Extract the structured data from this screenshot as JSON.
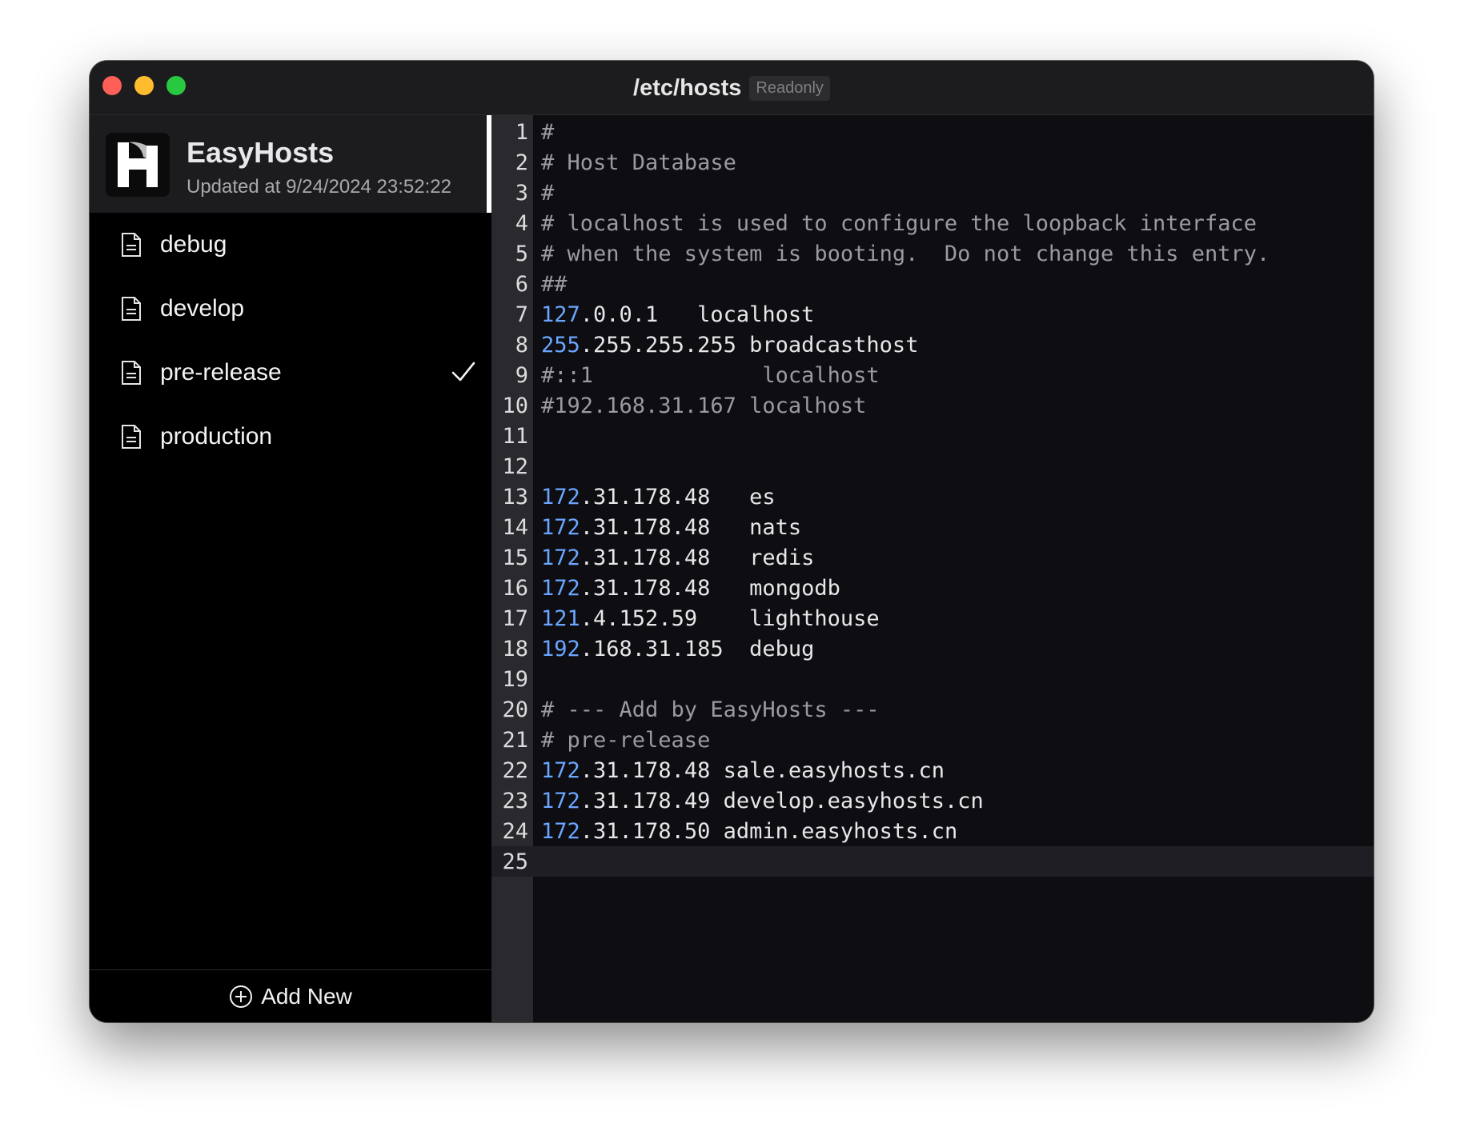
{
  "window": {
    "title": "/etc/hosts",
    "badge": "Readonly"
  },
  "app": {
    "name": "EasyHosts",
    "updated": "Updated at 9/24/2024 23:52:22",
    "logo_icon": "easyhosts-h-logo"
  },
  "profiles": [
    {
      "label": "debug",
      "checked": false
    },
    {
      "label": "develop",
      "checked": false
    },
    {
      "label": "pre-release",
      "checked": true
    },
    {
      "label": "production",
      "checked": false
    }
  ],
  "footer": {
    "add_label": "Add New",
    "add_icon": "plus-circle-icon"
  },
  "colors": {
    "comment": "#9a9aa0",
    "ip_octet": "#6aa6ff",
    "text": "#e7e7ea",
    "close": "#fe5f57",
    "minimize": "#febc2e",
    "maximize": "#28c840"
  },
  "editor": {
    "active_line": 25,
    "lines": [
      {
        "n": "1",
        "type": "comment",
        "text": "#"
      },
      {
        "n": "2",
        "type": "comment",
        "text": "# Host Database"
      },
      {
        "n": "3",
        "type": "comment",
        "text": "#"
      },
      {
        "n": "4",
        "type": "comment",
        "text": "# localhost is used to configure the loopback interface"
      },
      {
        "n": "5",
        "type": "comment",
        "text": "# when the system is booting.  Do not change this entry."
      },
      {
        "n": "6",
        "type": "comment",
        "text": "##"
      },
      {
        "n": "7",
        "type": "entry",
        "ip_head": "127",
        "ip_tail": ".0.0.1",
        "gap": "   ",
        "host": "localhost"
      },
      {
        "n": "8",
        "type": "entry",
        "ip_head": "255",
        "ip_tail": ".255.255.255",
        "gap": " ",
        "host": "broadcasthost"
      },
      {
        "n": "9",
        "type": "comment",
        "text": "#::1             localhost"
      },
      {
        "n": "10",
        "type": "comment",
        "text": "#192.168.31.167 localhost"
      },
      {
        "n": "11",
        "type": "empty",
        "text": ""
      },
      {
        "n": "12",
        "type": "empty",
        "text": ""
      },
      {
        "n": "13",
        "type": "entry",
        "ip_head": "172",
        "ip_tail": ".31.178.48",
        "gap": "   ",
        "host": "es"
      },
      {
        "n": "14",
        "type": "entry",
        "ip_head": "172",
        "ip_tail": ".31.178.48",
        "gap": "   ",
        "host": "nats"
      },
      {
        "n": "15",
        "type": "entry",
        "ip_head": "172",
        "ip_tail": ".31.178.48",
        "gap": "   ",
        "host": "redis"
      },
      {
        "n": "16",
        "type": "entry",
        "ip_head": "172",
        "ip_tail": ".31.178.48",
        "gap": "   ",
        "host": "mongodb"
      },
      {
        "n": "17",
        "type": "entry",
        "ip_head": "121",
        "ip_tail": ".4.152.59",
        "gap": "    ",
        "host": "lighthouse"
      },
      {
        "n": "18",
        "type": "entry",
        "ip_head": "192",
        "ip_tail": ".168.31.185",
        "gap": "  ",
        "host": "debug"
      },
      {
        "n": "19",
        "type": "empty",
        "text": ""
      },
      {
        "n": "20",
        "type": "comment",
        "text": "# --- Add by EasyHosts ---"
      },
      {
        "n": "21",
        "type": "comment",
        "text": "# pre-release"
      },
      {
        "n": "22",
        "type": "entry",
        "ip_head": "172",
        "ip_tail": ".31.178.48",
        "gap": " ",
        "host": "sale.easyhosts.cn"
      },
      {
        "n": "23",
        "type": "entry",
        "ip_head": "172",
        "ip_tail": ".31.178.49",
        "gap": " ",
        "host": "develop.easyhosts.cn"
      },
      {
        "n": "24",
        "type": "entry",
        "ip_head": "172",
        "ip_tail": ".31.178.50",
        "gap": " ",
        "host": "admin.easyhosts.cn"
      },
      {
        "n": "25",
        "type": "empty",
        "text": ""
      }
    ]
  }
}
